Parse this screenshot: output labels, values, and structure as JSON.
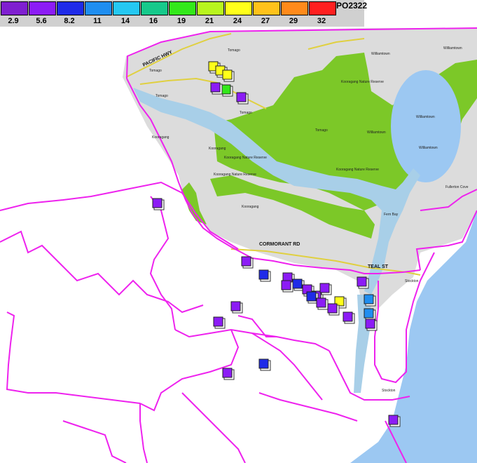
{
  "legend": {
    "map_id": "PO2322",
    "swatches": [
      {
        "label": "2.9",
        "color": "#7f1fd0"
      },
      {
        "label": "5.6",
        "color": "#8c1cf5"
      },
      {
        "label": "8.2",
        "color": "#1f2be8"
      },
      {
        "label": "11",
        "color": "#1f8ef0"
      },
      {
        "label": "14",
        "color": "#25c8f2"
      },
      {
        "label": "16",
        "color": "#16c98b"
      },
      {
        "label": "19",
        "color": "#33e81a"
      },
      {
        "label": "21",
        "color": "#b8f51e"
      },
      {
        "label": "24",
        "color": "#ffff1a"
      },
      {
        "label": "27",
        "color": "#ffc21a"
      },
      {
        "label": "29",
        "color": "#ff8a1a"
      },
      {
        "label": "32",
        "color": "#ff1f1f"
      }
    ]
  },
  "map": {
    "colors": {
      "water": "#9cc8f2",
      "river": "#a8cfe8",
      "land": "#dcdcdc",
      "reserve": "#7cc828",
      "boundary": "#ee22ee",
      "road": "#e0d040"
    },
    "labels": {
      "pacific_hwy": "PACIFIC HWY",
      "cormorant_rd": "CORMORANT RD",
      "teal_st": "TEAL ST",
      "tomago1": "Tomago",
      "tomago2": "Tomago",
      "tomago3": "Tomago",
      "tomago4": "Tomago",
      "tomago5": "Tomago",
      "williamtown1": "Williamtown",
      "williamtown2": "Williamtown",
      "williamtown3": "Williamtown",
      "williamtown4": "Williamtown",
      "williamtown5": "Williamtown",
      "kooragang1": "Kooragang",
      "kooragang2": "Kooragang",
      "kooragang3": "Kooragang",
      "reserve1": "Kooragang Nature Reserve",
      "reserve2": "Kooragang Nature Reserve",
      "reserve3": "Kooragang Nature Reserve",
      "reserve4": "Kooragang Nature Reserve",
      "fern_bay": "Fern Bay",
      "fullerton": "Fullerton Cove",
      "stockton": "Stockton",
      "stockton2": "Stockton"
    },
    "sites": [
      {
        "value": "24",
        "color": "#ffff1a",
        "shadow": "#c8a000"
      },
      {
        "value": "24",
        "color": "#ffff1a",
        "shadow": "#c8a000"
      },
      {
        "value": "24",
        "color": "#ffff1a",
        "shadow": "#c8a000"
      },
      {
        "value": "19",
        "color": "#33e81a",
        "shadow": "#1a7a10"
      },
      {
        "value": "5.6",
        "color": "#8c1cf5",
        "shadow": "#333"
      },
      {
        "value": "5.6",
        "color": "#8c1cf5",
        "shadow": "#333"
      },
      {
        "value": "5.6",
        "color": "#8c1cf5",
        "shadow": "#333"
      },
      {
        "value": "5.6",
        "color": "#8c1cf5",
        "shadow": "#333"
      },
      {
        "value": "8.2",
        "color": "#1f2be8",
        "shadow": "#333"
      },
      {
        "value": "5.6",
        "color": "#8c1cf5",
        "shadow": "#333"
      },
      {
        "value": "8.2",
        "color": "#1f2be8",
        "shadow": "#333"
      },
      {
        "value": "5.6",
        "color": "#8c1cf5",
        "shadow": "#333"
      },
      {
        "value": "5.6",
        "color": "#8c1cf5",
        "shadow": "#333"
      },
      {
        "value": "8.2",
        "color": "#1f2be8",
        "shadow": "#333"
      },
      {
        "value": "5.6",
        "color": "#8c1cf5",
        "shadow": "#333"
      },
      {
        "value": "5.6",
        "color": "#8c1cf5",
        "shadow": "#333"
      },
      {
        "value": "24",
        "color": "#ffff1a",
        "shadow": "#333"
      },
      {
        "value": "5.6",
        "color": "#8c1cf5",
        "shadow": "#333"
      },
      {
        "value": "5.6",
        "color": "#8c1cf5",
        "shadow": "#333"
      },
      {
        "value": "5.6",
        "color": "#8c1cf5",
        "shadow": "#333"
      },
      {
        "value": "11",
        "color": "#1f8ef0",
        "shadow": "#333"
      },
      {
        "value": "11",
        "color": "#1f8ef0",
        "shadow": "#333"
      },
      {
        "value": "5.6",
        "color": "#8c1cf5",
        "shadow": "#333"
      },
      {
        "value": "5.6",
        "color": "#8c1cf5",
        "shadow": "#333"
      },
      {
        "value": "5.6",
        "color": "#8c1cf5",
        "shadow": "#333"
      },
      {
        "value": "5.6",
        "color": "#8c1cf5",
        "shadow": "#333"
      },
      {
        "value": "8.2",
        "color": "#1f2be8",
        "shadow": "#333"
      },
      {
        "value": "5.6",
        "color": "#8c1cf5",
        "shadow": "#333"
      },
      {
        "value": "5.6",
        "color": "#8c1cf5",
        "shadow": "#333"
      }
    ]
  }
}
